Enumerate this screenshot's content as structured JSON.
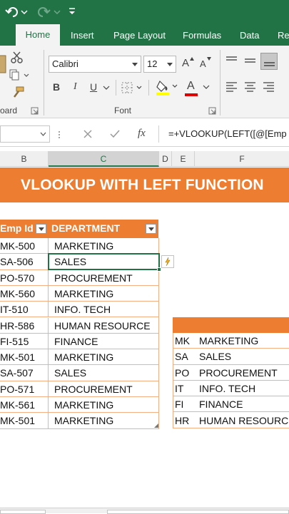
{
  "ribbon": {
    "tabs": [
      {
        "label": "Home",
        "active": true
      },
      {
        "label": "Insert"
      },
      {
        "label": "Page Layout"
      },
      {
        "label": "Formulas"
      },
      {
        "label": "Data"
      },
      {
        "label": "Rev"
      }
    ],
    "clipboard_label": "oard",
    "font_label": "Font",
    "font_name": "Calibri",
    "font_size": "12",
    "bold": "B",
    "italic": "I",
    "underline": "U",
    "grow_font": "A",
    "shrink_font": "A",
    "font_color_letter": "A"
  },
  "formula_bar": {
    "fx": "fx",
    "formula": "=+VLOOKUP(LEFT([@[Emp"
  },
  "columns": [
    "B",
    "C",
    "D",
    "E",
    "F"
  ],
  "banner_title": "VLOOKUP WITH LEFT FUNCTION",
  "table1": {
    "headers": [
      "Emp Id",
      "DEPARTMENT"
    ],
    "rows": [
      {
        "id": "MK-500",
        "dept": "MARKETING"
      },
      {
        "id": "SA-506",
        "dept": "SALES"
      },
      {
        "id": "PO-570",
        "dept": "PROCUREMENT"
      },
      {
        "id": "MK-560",
        "dept": "MARKETING"
      },
      {
        "id": "IT-510",
        "dept": "INFO. TECH"
      },
      {
        "id": "HR-586",
        "dept": "HUMAN RESOURCE"
      },
      {
        "id": "FI-515",
        "dept": "FINANCE"
      },
      {
        "id": "MK-501",
        "dept": "MARKETING"
      },
      {
        "id": "SA-507",
        "dept": "SALES"
      },
      {
        "id": "PO-571",
        "dept": "PROCUREMENT"
      },
      {
        "id": "MK-561",
        "dept": "MARKETING"
      },
      {
        "id": "MK-501",
        "dept": "MARKETING"
      }
    ]
  },
  "table2": {
    "rows": [
      {
        "code": "MK",
        "dept": "MARKETING"
      },
      {
        "code": "SA",
        "dept": "SALES"
      },
      {
        "code": "PO",
        "dept": "PROCUREMENT"
      },
      {
        "code": "IT",
        "dept": "INFO. TECH"
      },
      {
        "code": "FI",
        "dept": "FINANCE"
      },
      {
        "code": "HR",
        "dept": "HUMAN RESOURCE"
      }
    ]
  },
  "colors": {
    "excel_green": "#217346",
    "table_orange": "#ed7d31",
    "table_border": "#f4b083",
    "selection_green": "#217346"
  }
}
